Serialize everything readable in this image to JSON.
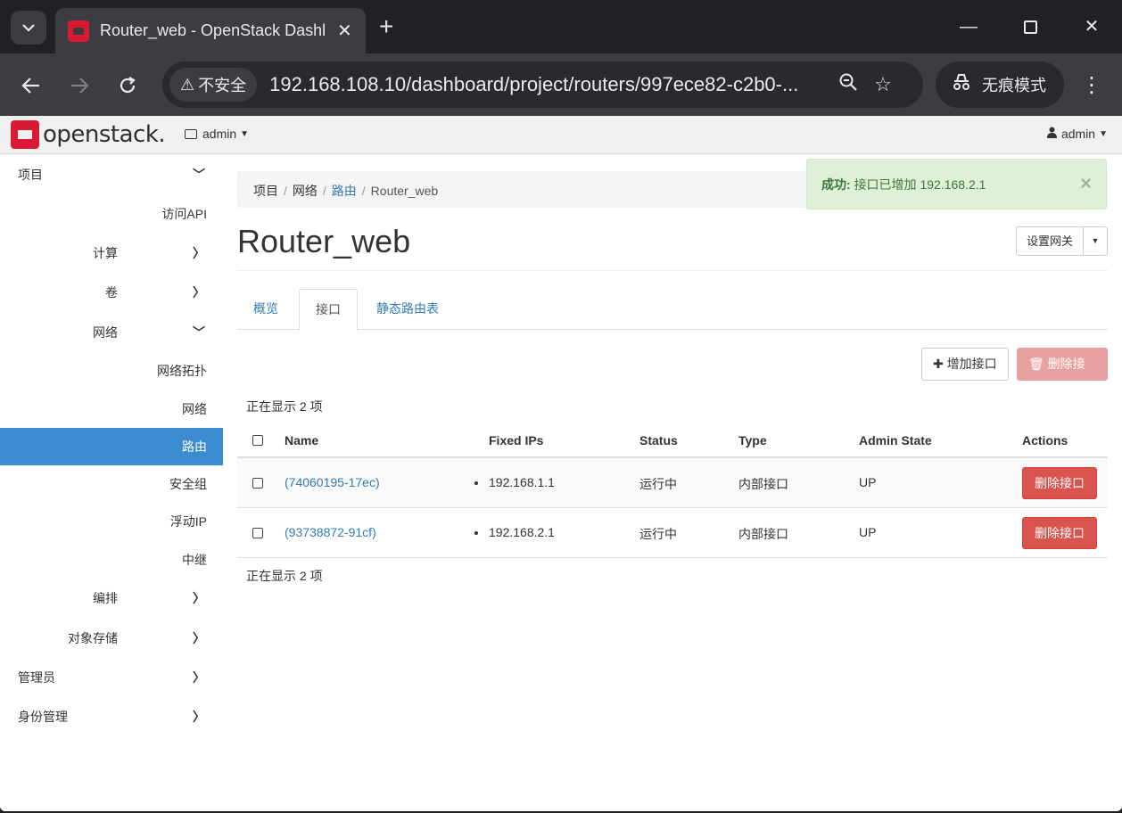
{
  "browser": {
    "tab_title": "Router_web - OpenStack Dashboard",
    "security_label": "不安全",
    "url": "192.168.108.10/dashboard/project/routers/997ece82-c2b0-...",
    "incognito_label": "无痕模式"
  },
  "topnav": {
    "logo_text": "openstack.",
    "project": "admin",
    "user": "admin"
  },
  "sidebar": {
    "project": "项目",
    "access_api": "访问API",
    "compute": "计算",
    "volumes": "卷",
    "network": "网络",
    "network_topology": "网络拓扑",
    "networks": "网络",
    "routers": "路由",
    "security_groups": "安全组",
    "floating_ips": "浮动IP",
    "trunks": "中继",
    "orchestration": "编排",
    "object_store": "对象存储",
    "admin": "管理员",
    "identity": "身份管理"
  },
  "breadcrumb": {
    "project": "项目",
    "network": "网络",
    "routers": "路由",
    "current": "Router_web"
  },
  "alert": {
    "label": "成功:",
    "message": "接口已增加 192.168.2.1",
    "close": "×"
  },
  "page": {
    "title": "Router_web",
    "set_gateway": "设置网关"
  },
  "tabs": {
    "overview": "概览",
    "interfaces": "接口",
    "static_routes": "静态路由表"
  },
  "actions": {
    "add_interface": "增加接口",
    "delete_interfaces": "删除接口"
  },
  "table": {
    "count_text": "正在显示 2 项",
    "columns": {
      "name": "Name",
      "fixed_ips": "Fixed IPs",
      "status": "Status",
      "type": "Type",
      "admin_state": "Admin State",
      "actions": "Actions"
    },
    "rows": [
      {
        "name": "(74060195-17ec)",
        "fixed_ip": "192.168.1.1",
        "status": "运行中",
        "type": "内部接口",
        "admin_state": "UP",
        "action": "删除接口"
      },
      {
        "name": "(93738872-91cf)",
        "fixed_ip": "192.168.2.1",
        "status": "运行中",
        "type": "内部接口",
        "admin_state": "UP",
        "action": "删除接口"
      }
    ]
  },
  "colors": {
    "primary": "#3b8bd1",
    "danger": "#d9534f",
    "success_bg": "#dff0d8",
    "brand": "#da1a32"
  }
}
